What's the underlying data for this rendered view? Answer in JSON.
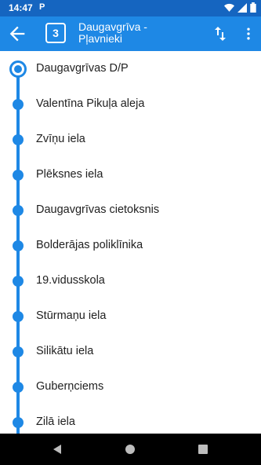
{
  "status_bar": {
    "time": "14:47",
    "app_icon": "P"
  },
  "app_bar": {
    "back_icon": "arrow-back-icon",
    "route_number": "3",
    "title_line1": "Daugavgrīva -",
    "title_line2": "Pļavnieki",
    "swap_icon": "swap-vertical-icon",
    "more_icon": "more-vert-icon"
  },
  "stops": [
    {
      "name": "Daugavgrīvas D/P",
      "current": true
    },
    {
      "name": "Valentīna Pikuļa aleja"
    },
    {
      "name": "Zvīņu iela"
    },
    {
      "name": "Plēksnes iela"
    },
    {
      "name": "Daugavgrīvas cietoksnis"
    },
    {
      "name": "Bolderājas poliklīnika"
    },
    {
      "name": "19.vidusskola"
    },
    {
      "name": "Stūrmaņu iela"
    },
    {
      "name": "Silikātu iela"
    },
    {
      "name": "Guberņciems"
    },
    {
      "name": "Zilā iela"
    }
  ],
  "colors": {
    "primary": "#1e88e5",
    "status_bar": "#1565c0",
    "text": "#212121"
  }
}
